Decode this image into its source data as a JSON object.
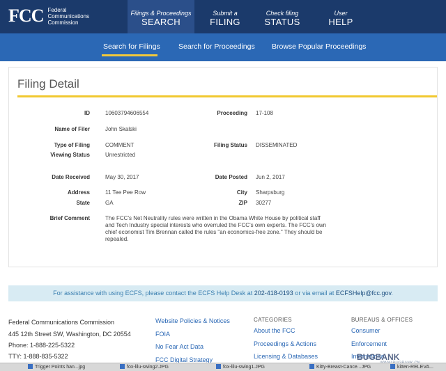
{
  "header": {
    "logo_mark": "FCC",
    "logo_text": "Federal Communications Commission",
    "nav": [
      {
        "small": "Filings & Proceedings",
        "big": "SEARCH"
      },
      {
        "small": "Submit a",
        "big": "FILING"
      },
      {
        "small": "Check filing",
        "big": "STATUS"
      },
      {
        "small": "User",
        "big": "HELP"
      }
    ]
  },
  "subnav": {
    "search_filings": "Search for Filings",
    "search_proceedings": "Search for Proceedings",
    "browse_popular": "Browse Popular Proceedings"
  },
  "filing": {
    "title": "Filing Detail",
    "id_label": "ID",
    "id_value": "10603794606554",
    "proceeding_label": "Proceeding",
    "proceeding_value": "17-108",
    "filer_label": "Name of Filer",
    "filer_value": "John Skalski",
    "type_label": "Type of Filing",
    "type_value": "COMMENT",
    "viewing_label": "Viewing Status",
    "viewing_value": "Unrestricted",
    "status_label": "Filing Status",
    "status_value": "DISSEMINATED",
    "received_label": "Date Received",
    "received_value": "May 30, 2017",
    "posted_label": "Date Posted",
    "posted_value": "Jun 2, 2017",
    "address_label": "Address",
    "address_value": "11 Tee Pee Row",
    "city_label": "City",
    "city_value": "Sharpsburg",
    "state_label": "State",
    "state_value": "GA",
    "zip_label": "ZIP",
    "zip_value": "30277",
    "comment_label": "Brief Comment",
    "comment_value": "The FCC's Net Neutrality rules were written in the Obama White House by political staff and Tech Industry special interests who overruled the FCC's own experts. The FCC's own chief economist Tim Brennan called the rules \"an economics-free zone.\" They should be repealed."
  },
  "help": {
    "text_a": "For assistance with using ECFS, please contact the ECFS Help Desk at ",
    "phone": "202-418-0193",
    "text_b": " or via email at ",
    "email": "ECFSHelp@fcc.gov",
    "text_c": "."
  },
  "footer": {
    "org": "Federal Communications Commission",
    "address": "445 12th Street SW, Washington, DC 20554",
    "phone": "Phone: 1-888-225-5322",
    "tty": "TTY: 1-888-835-5322",
    "links_col": [
      "Website Policies & Notices",
      "FOIA",
      "No Fear Act Data",
      "FCC Digital Strategy"
    ],
    "categories_head": "CATEGORIES",
    "categories": [
      "About the FCC",
      "Proceedings & Actions",
      "Licensing & Databases"
    ],
    "bureaus_head": "BUREAUS & OFFICES",
    "bureaus": [
      "Consumer",
      "Enforcement",
      "International"
    ]
  },
  "taskbar": {
    "items": [
      "Trigger Points han...jpg",
      "fox-lilu-swing2.JPG",
      "fox-lilu-swing1.JPG",
      "Kitty-Breast-Cance...JPG",
      "kitten-RELEVA..."
    ]
  },
  "watermark": {
    "brand": "BUGBANK",
    "url": "WWW.BUGBANK.CN"
  }
}
